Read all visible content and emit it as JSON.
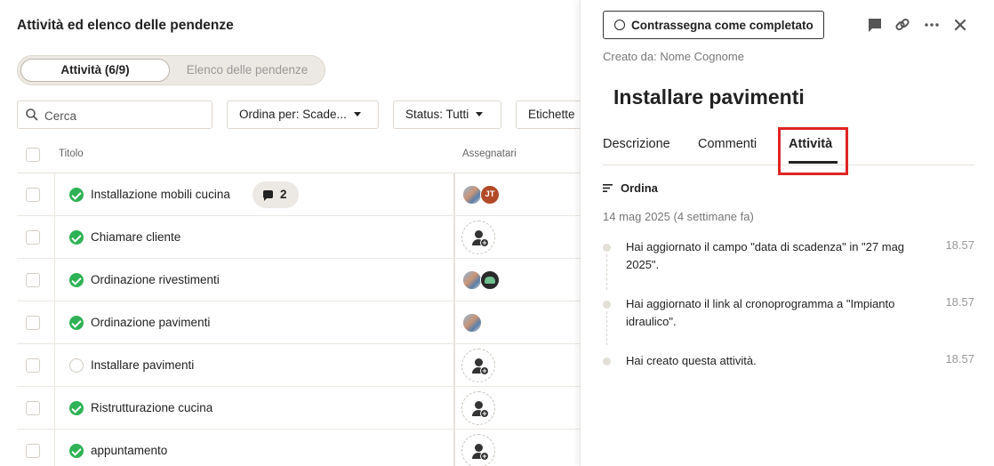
{
  "page_title": "Attività ed elenco delle pendenze",
  "segmented": {
    "active": "Attività (6/9)",
    "inactive": "Elenco delle pendenze"
  },
  "search": {
    "placeholder": "Cerca"
  },
  "filters": {
    "sort": "Ordina per: Scade...",
    "status": "Status: Tutti",
    "labels": "Etichette"
  },
  "table": {
    "col_title": "Titolo",
    "col_assignees": "Assegnatari",
    "rows": [
      {
        "title": "Installazione mobili cucina",
        "done": true,
        "comments": "2",
        "assignees": [
          "photo",
          "JT"
        ]
      },
      {
        "title": "Chiamare cliente",
        "done": true,
        "assignees": []
      },
      {
        "title": "Ordinazione rivestimenti",
        "done": true,
        "assignees": [
          "photo",
          "dark"
        ]
      },
      {
        "title": "Ordinazione pavimenti",
        "done": true,
        "assignees": [
          "photo"
        ]
      },
      {
        "title": "Installare pavimenti",
        "done": false,
        "assignees": []
      },
      {
        "title": "Ristrutturazione cucina",
        "done": true,
        "assignees": []
      },
      {
        "title": "appuntamento",
        "done": true,
        "assignees": []
      }
    ]
  },
  "detail": {
    "complete_button": "Contrassegna come completato",
    "created_by": "Creato da: Nome Cognome",
    "title": "Installare pavimenti",
    "tabs": [
      "Descrizione",
      "Commenti",
      "Attività"
    ],
    "active_tab": "Attività",
    "sort_label": "Ordina",
    "date_header": "14 mag 2025 (4 settimane fa)",
    "activities": [
      {
        "text": "Hai aggiornato il campo \"data di scadenza\" in \"27 mag 2025\".",
        "time": "18.57"
      },
      {
        "text": "Hai aggiornato il link al cronoprogramma a \"Impianto idraulico\".",
        "time": "18.57"
      },
      {
        "text": "Hai creato questa attività.",
        "time": "18.57"
      }
    ]
  },
  "colors": {
    "done_green": "#2eb255",
    "highlight_red": "#e02424",
    "avatar_jt": "#b24a28"
  },
  "icons": [
    "search-icon",
    "caret-down-icon",
    "comment-icon",
    "link-icon",
    "more-icon",
    "close-icon",
    "sort-icon",
    "add-assignee-icon"
  ]
}
